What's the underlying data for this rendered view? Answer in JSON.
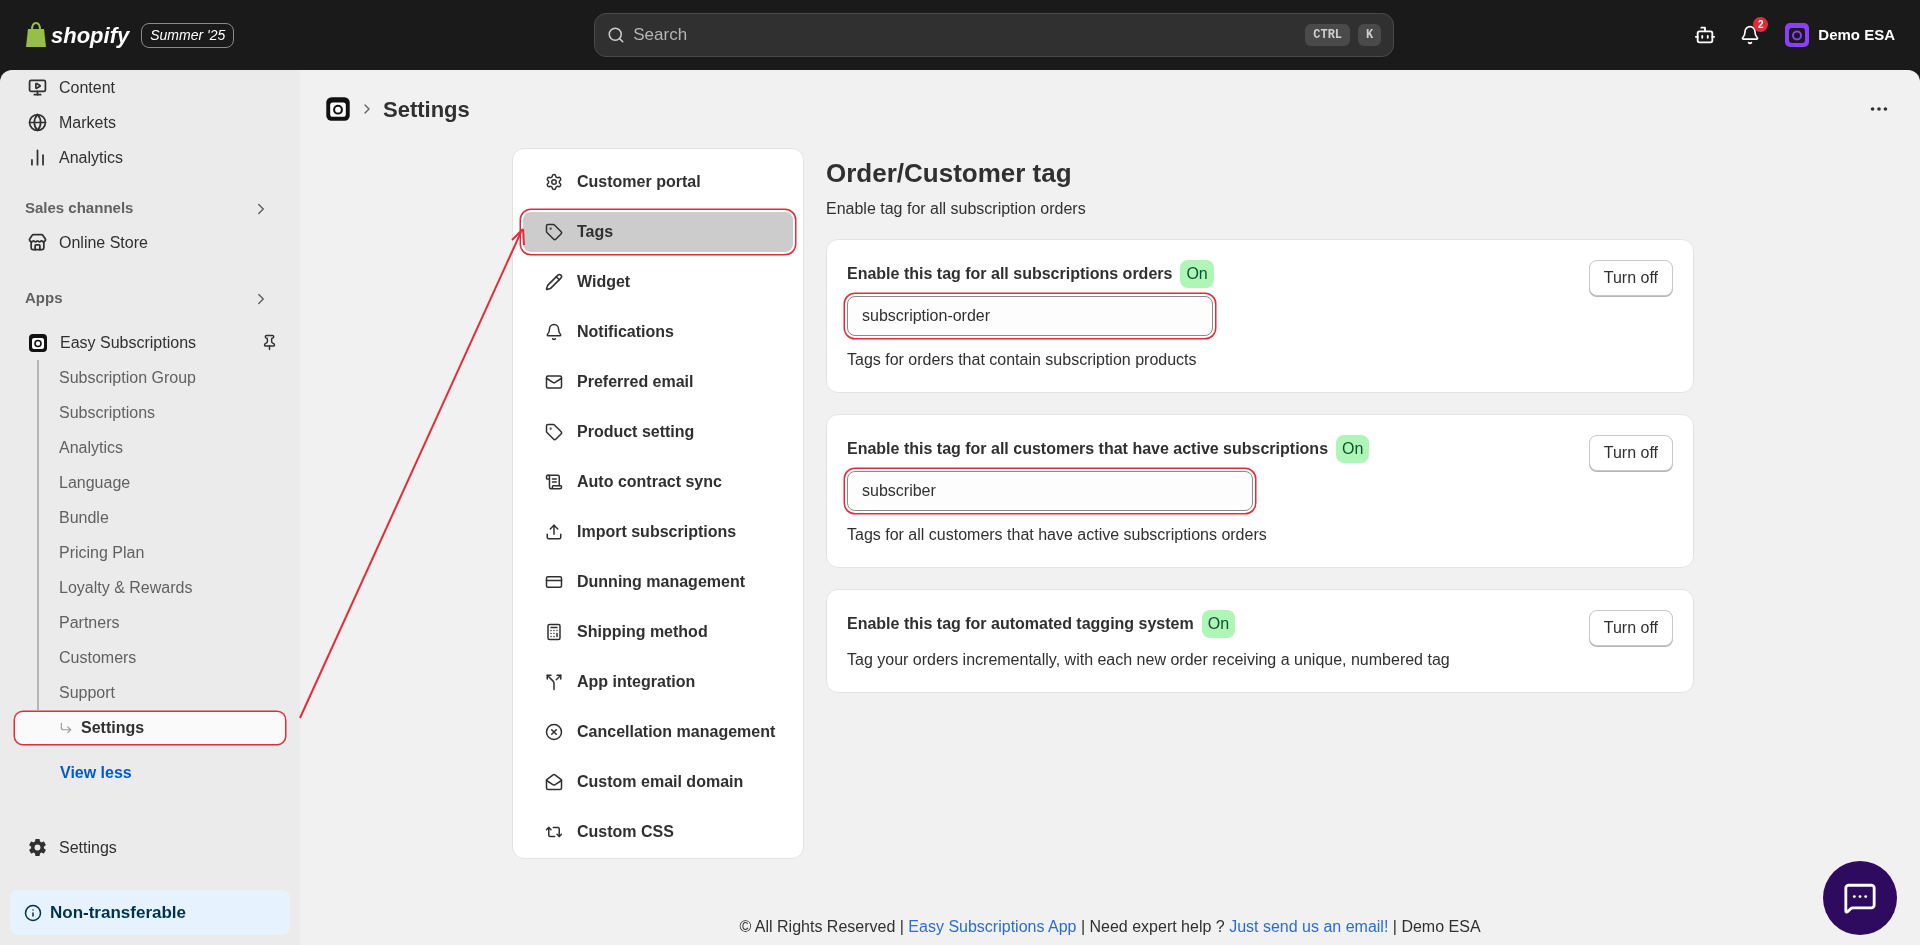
{
  "topbar": {
    "brand": "shopify",
    "edition": "Summer '25",
    "search": {
      "placeholder": "Search",
      "shortcut": [
        "CTRL",
        "K"
      ]
    },
    "notification_count": "2",
    "store": "Demo ESA"
  },
  "sidebar": {
    "items": [
      {
        "label": "Content"
      },
      {
        "label": "Markets"
      },
      {
        "label": "Analytics"
      }
    ],
    "sales_channels": {
      "title": "Sales channels",
      "items": [
        {
          "label": "Online Store"
        }
      ]
    },
    "apps": {
      "title": "Apps",
      "app": {
        "label": "Easy Subscriptions",
        "children": [
          {
            "label": "Subscription Group",
            "selected": false,
            "annotated": false
          },
          {
            "label": "Subscriptions",
            "selected": false,
            "annotated": false
          },
          {
            "label": "Analytics",
            "selected": false,
            "annotated": false
          },
          {
            "label": "Language",
            "selected": false,
            "annotated": false
          },
          {
            "label": "Bundle",
            "selected": false,
            "annotated": false
          },
          {
            "label": "Pricing Plan",
            "selected": false,
            "annotated": false
          },
          {
            "label": "Loyalty & Rewards",
            "selected": false,
            "annotated": false
          },
          {
            "label": "Partners",
            "selected": false,
            "annotated": false
          },
          {
            "label": "Customers",
            "selected": false,
            "annotated": false
          },
          {
            "label": "Support",
            "selected": false,
            "annotated": false
          },
          {
            "label": "Settings",
            "selected": true,
            "annotated": true
          }
        ]
      }
    },
    "view_less": "View less",
    "settings": "Settings",
    "plan_badge": "Non-transferable"
  },
  "page": {
    "title": "Settings"
  },
  "settings_menu": [
    {
      "label": "Customer portal",
      "selected": false,
      "annotated": false
    },
    {
      "label": "Tags",
      "selected": true,
      "annotated": true
    },
    {
      "label": "Widget",
      "selected": false,
      "annotated": false
    },
    {
      "label": "Notifications",
      "selected": false,
      "annotated": false
    },
    {
      "label": "Preferred email",
      "selected": false,
      "annotated": false
    },
    {
      "label": "Product setting",
      "selected": false,
      "annotated": false
    },
    {
      "label": "Auto contract sync",
      "selected": false,
      "annotated": false
    },
    {
      "label": "Import subscriptions",
      "selected": false,
      "annotated": false
    },
    {
      "label": "Dunning management",
      "selected": false,
      "annotated": false
    },
    {
      "label": "Shipping method",
      "selected": false,
      "annotated": false
    },
    {
      "label": "App integration",
      "selected": false,
      "annotated": false
    },
    {
      "label": "Cancellation management",
      "selected": false,
      "annotated": false
    },
    {
      "label": "Custom email domain",
      "selected": false,
      "annotated": false
    },
    {
      "label": "Custom CSS",
      "selected": false,
      "annotated": false
    }
  ],
  "content": {
    "title": "Order/Customer tag",
    "subtitle": "Enable tag for all subscription orders",
    "cards": [
      {
        "label": "Enable this tag for all subscriptions orders",
        "status": "On",
        "on": true,
        "value": "subscription-order",
        "annotated": true,
        "help": "Tags for orders that contain subscription products",
        "action": "Turn off"
      },
      {
        "label": "Enable this tag for all customers that have active subscriptions",
        "status": "On",
        "on": true,
        "value": "subscriber",
        "annotated": true,
        "help": "Tags for all customers that have active subscriptions orders",
        "action": "Turn off"
      },
      {
        "label": "Enable this tag for automated tagging system",
        "status": "On",
        "on": true,
        "help": "Tag your orders incrementally, with each new order receiving a unique, numbered tag",
        "action": "Turn off"
      }
    ]
  },
  "footer": [
    {
      "kind": "text",
      "text": "© All Rights Reserved | "
    },
    {
      "kind": "link",
      "text": "Easy Subscriptions App"
    },
    {
      "kind": "text",
      "text": " | Need expert help ? "
    },
    {
      "kind": "link",
      "text": "Just send us an email!"
    },
    {
      "kind": "text",
      "text": " | Demo ESA"
    }
  ]
}
